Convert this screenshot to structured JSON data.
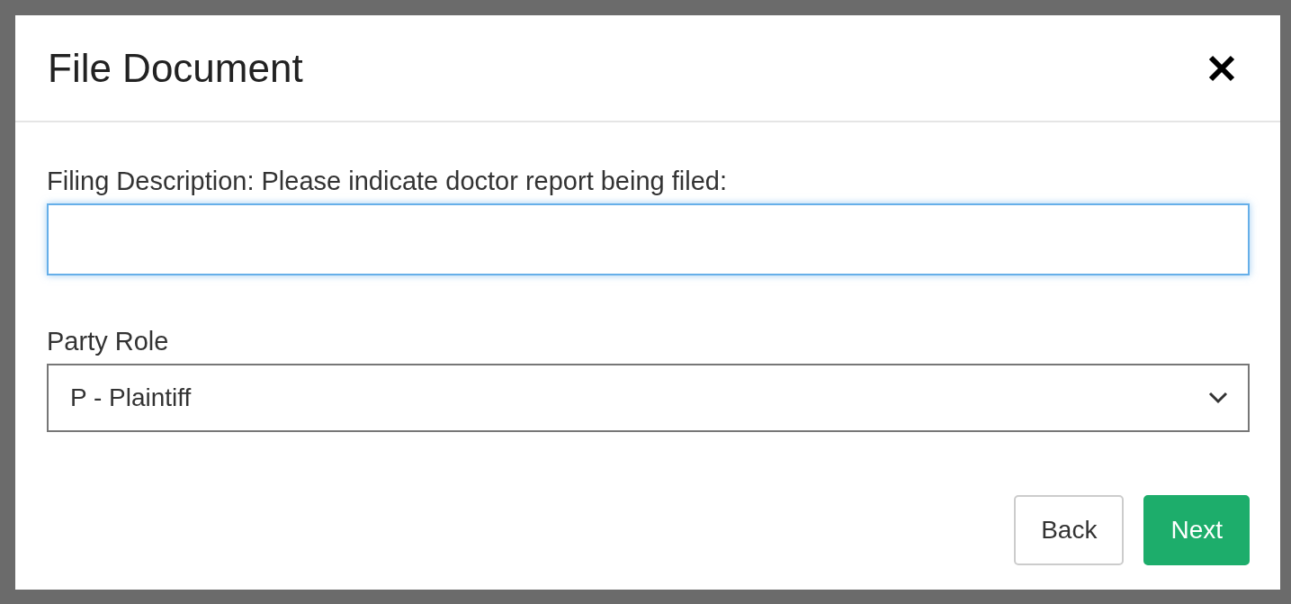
{
  "dialog": {
    "title": "File Document"
  },
  "fields": [
    {
      "kind": "text",
      "label": "Filing Description: Please indicate doctor report being filed:",
      "focused": true
    },
    {
      "kind": "select",
      "label": "Party Role",
      "value": "P - Plaintiff"
    }
  ],
  "buttons": [
    {
      "kind": "secondary",
      "label": "Back"
    },
    {
      "kind": "primary",
      "label": "Next"
    }
  ]
}
